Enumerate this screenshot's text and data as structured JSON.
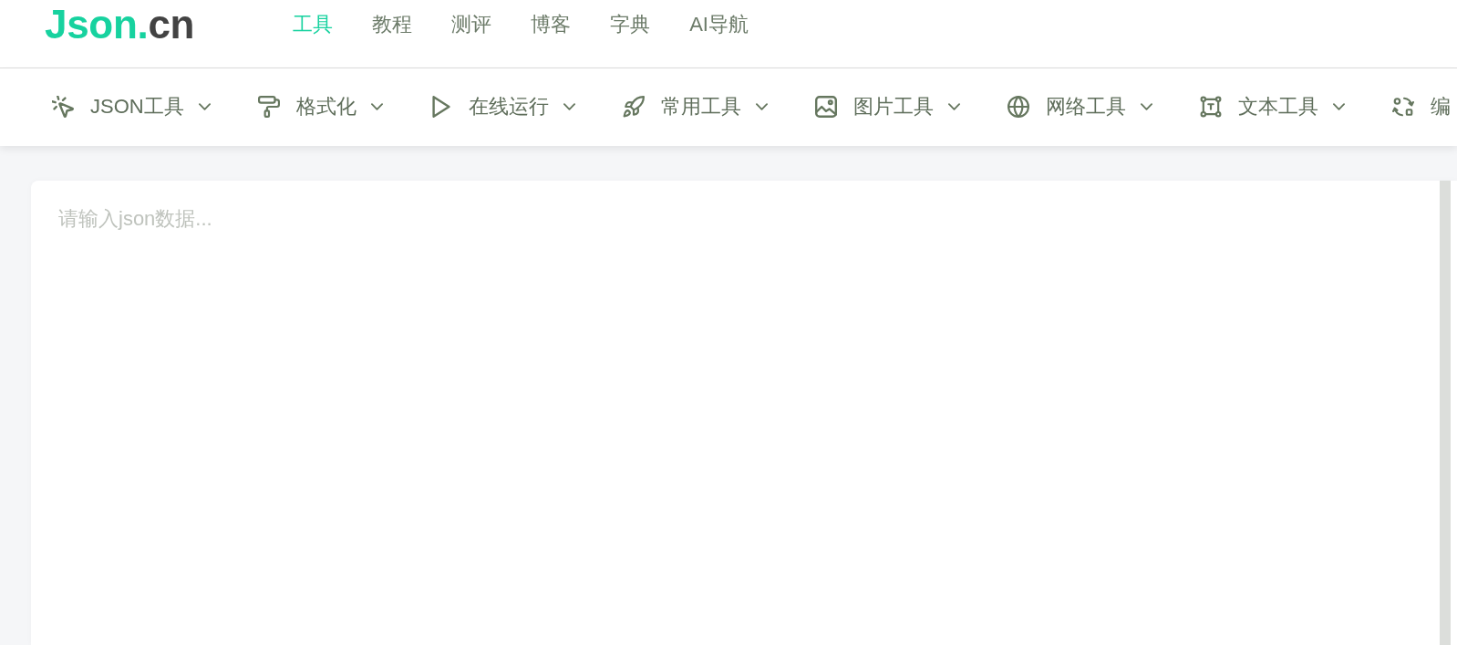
{
  "logo": {
    "brand": "Json.",
    "tld": "cn"
  },
  "nav": [
    {
      "label": "工具",
      "selected": true
    },
    {
      "label": "教程",
      "selected": false
    },
    {
      "label": "测评",
      "selected": false
    },
    {
      "label": "博客",
      "selected": false
    },
    {
      "label": "字典",
      "selected": false
    },
    {
      "label": "AI导航",
      "selected": false
    }
  ],
  "toolbar": [
    {
      "kind": "json",
      "label": "JSON工具",
      "has_menu": true
    },
    {
      "kind": "format",
      "label": "格式化",
      "has_menu": true
    },
    {
      "kind": "run",
      "label": "在线运行",
      "has_menu": true
    },
    {
      "kind": "common",
      "label": "常用工具",
      "has_menu": true
    },
    {
      "kind": "image",
      "label": "图片工具",
      "has_menu": true
    },
    {
      "kind": "network",
      "label": "网络工具",
      "has_menu": true
    },
    {
      "kind": "text",
      "label": "文本工具",
      "has_menu": true
    },
    {
      "kind": "encode",
      "label": "编",
      "has_menu": false
    }
  ],
  "editor": {
    "placeholder": "请输入json数据..."
  }
}
